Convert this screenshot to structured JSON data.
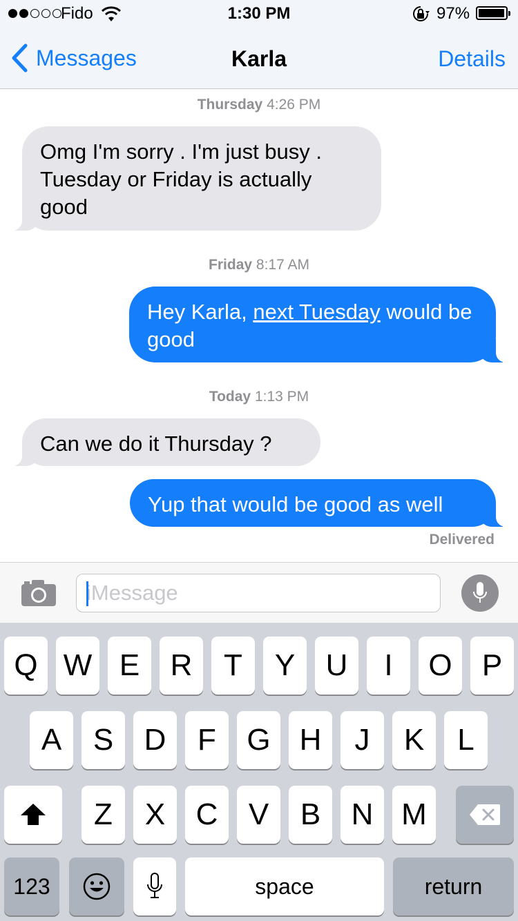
{
  "status_bar": {
    "carrier": "Fido",
    "signal_bars_filled": 2,
    "signal_bars_total": 5,
    "time": "1:30 PM",
    "battery_percent": "97%",
    "battery_level": 0.97
  },
  "nav": {
    "back_label": "Messages",
    "title": "Karla",
    "details_label": "Details"
  },
  "conversation": {
    "stamp1": {
      "day": "Thursday",
      "time": "4:26 PM"
    },
    "msg1": {
      "direction": "incoming",
      "text": "Omg I'm sorry . I'm just busy . Tuesday or Friday is actually good"
    },
    "stamp2": {
      "day": "Friday",
      "time": "8:17 AM"
    },
    "msg2": {
      "direction": "outgoing",
      "before": "Hey Karla, ",
      "link": "next Tuesday",
      "after": " would be good"
    },
    "stamp3": {
      "day": "Today",
      "time": "1:13 PM"
    },
    "msg3": {
      "direction": "incoming",
      "text": "Can we do it Thursday ?"
    },
    "msg4": {
      "direction": "outgoing",
      "text": "Yup that would be good as well"
    },
    "delivered": "Delivered"
  },
  "input_bar": {
    "placeholder": "iMessage",
    "value": ""
  },
  "keyboard": {
    "row1": [
      "Q",
      "W",
      "E",
      "R",
      "T",
      "Y",
      "U",
      "I",
      "O",
      "P"
    ],
    "row2": [
      "A",
      "S",
      "D",
      "F",
      "G",
      "H",
      "J",
      "K",
      "L"
    ],
    "row3": [
      "Z",
      "X",
      "C",
      "V",
      "B",
      "N",
      "M"
    ],
    "numbers_label": "123",
    "space_label": "space",
    "return_label": "return"
  },
  "colors": {
    "accent": "#157efb",
    "incoming_bubble": "#e5e5ea",
    "keyboard_bg": "#d1d5db",
    "timestamp_gray": "#8e8e93"
  },
  "icons": [
    "back-chevron-icon",
    "wifi-icon",
    "orientation-lock-icon",
    "battery-icon",
    "camera-icon",
    "microphone-icon",
    "shift-icon",
    "backspace-icon",
    "emoji-icon",
    "dictation-icon"
  ]
}
